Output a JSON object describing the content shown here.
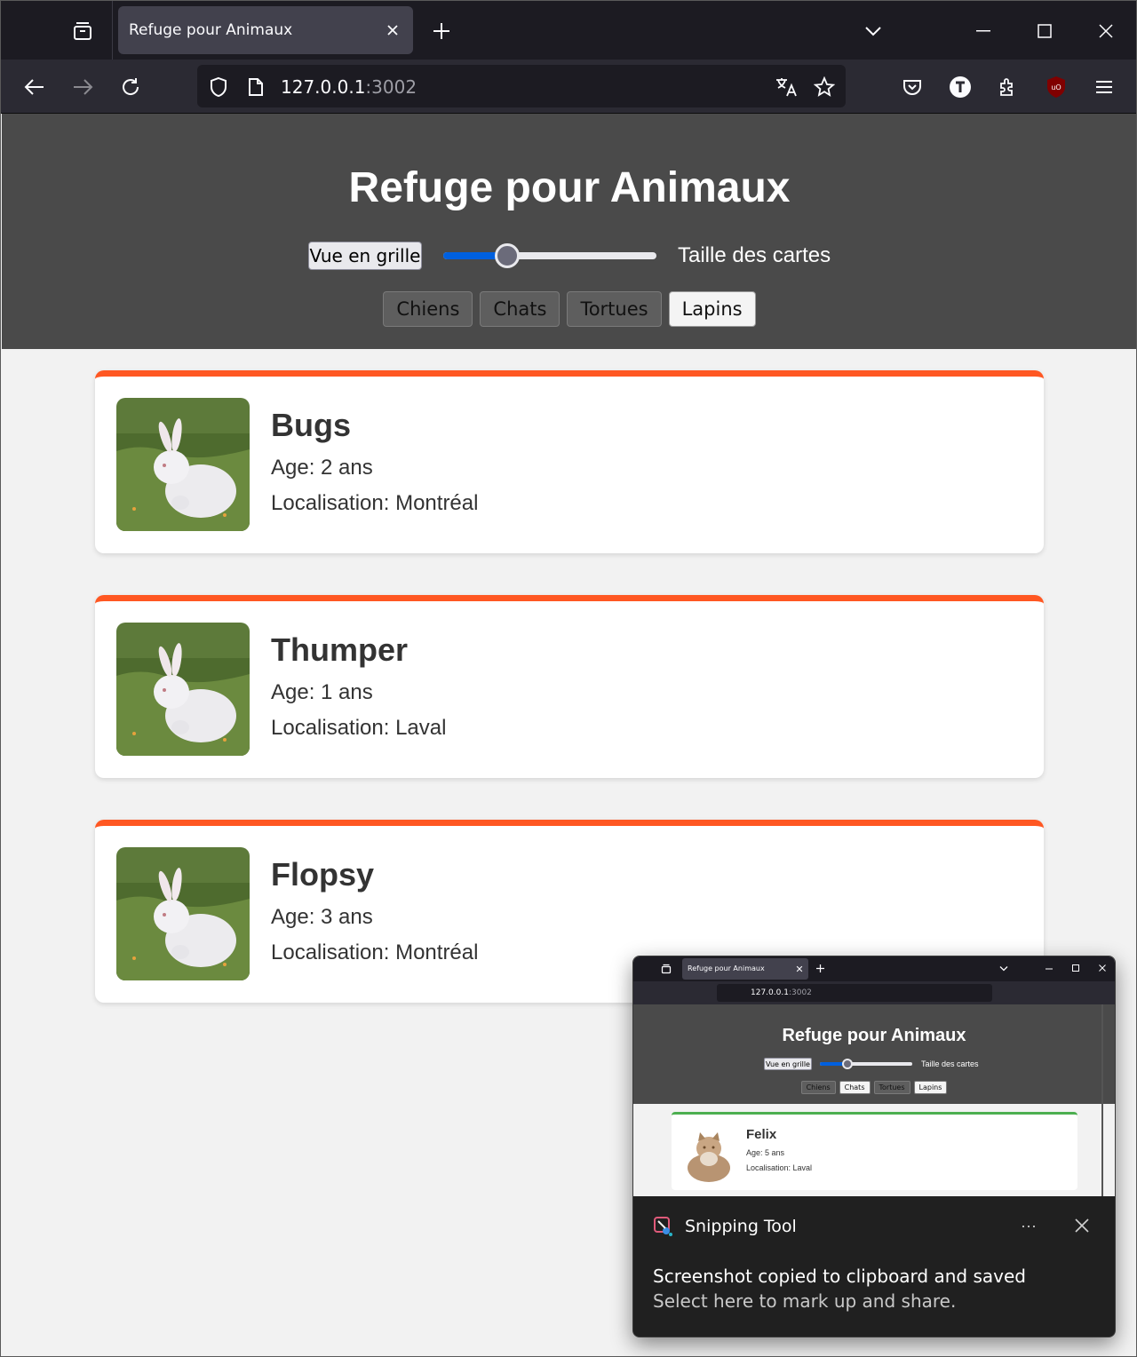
{
  "browser": {
    "tab_title": "Refuge pour Animaux",
    "url_host": "127.0.0.1",
    "url_port": ":3002",
    "icons": [
      "tab-overview-icon",
      "close-icon",
      "plus-icon",
      "chevron-down-icon",
      "minimize-icon",
      "maximize-icon",
      "window-close-icon",
      "back-icon",
      "forward-icon",
      "reload-icon",
      "shield-icon",
      "page-icon",
      "translate-icon",
      "star-icon",
      "pocket-icon",
      "t-extension-icon",
      "extensions-icon",
      "ublock-icon",
      "menu-icon"
    ]
  },
  "header": {
    "title": "Refuge pour Animaux",
    "grid_button": "Vue en grille",
    "slider_label": "Taille des cartes",
    "slider_value": 0.3,
    "filters": [
      "Chiens",
      "Chats",
      "Tortues",
      "Lapins"
    ],
    "active_filter": "Lapins"
  },
  "animals": [
    {
      "name": "Bugs",
      "age": "Age: 2 ans",
      "location": "Localisation: Montréal"
    },
    {
      "name": "Thumper",
      "age": "Age: 1 ans",
      "location": "Localisation: Laval"
    },
    {
      "name": "Flopsy",
      "age": "Age: 3 ans",
      "location": "Localisation: Montréal"
    }
  ],
  "colors": {
    "card_accent": "#ff5722",
    "preview_card_accent": "#4caf50",
    "header_bg": "#4a4a4a",
    "slider_fill": "#0060df"
  },
  "toast": {
    "app_name": "Snipping Tool",
    "line1": "Screenshot copied to clipboard and saved",
    "line2": "Select here to mark up and share.",
    "more": "···",
    "preview": {
      "tab_title": "Refuge pour Animaux",
      "url_host": "127.0.0.1",
      "url_port": ":3002",
      "title": "Refuge pour Animaux",
      "grid_button": "Vue en grille",
      "slider_label": "Taille des cartes",
      "slider_value": 0.3,
      "filters": [
        "Chiens",
        "Chats",
        "Tortues",
        "Lapins"
      ],
      "active_filters": [
        "Chats",
        "Lapins"
      ],
      "card": {
        "name": "Felix",
        "age": "Age: 5 ans",
        "location": "Localisation: Laval"
      }
    }
  }
}
